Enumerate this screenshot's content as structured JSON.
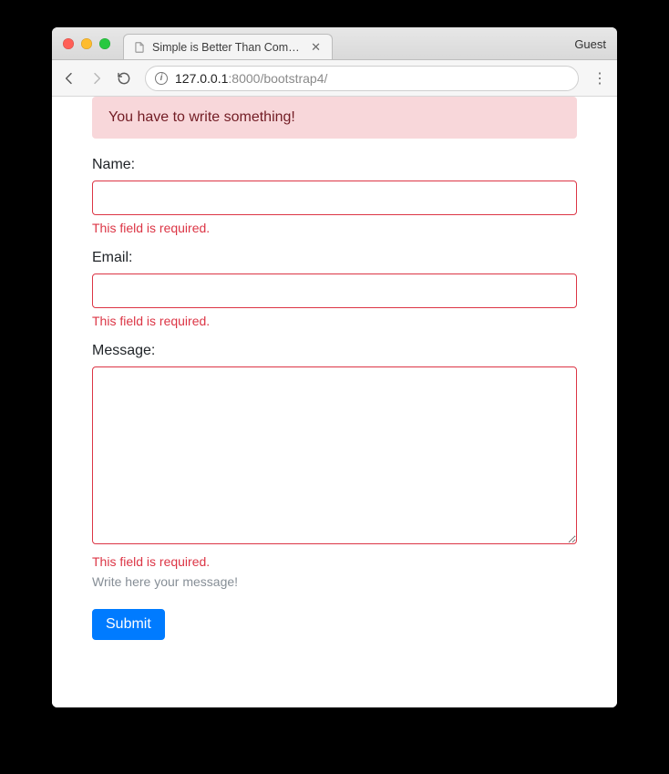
{
  "browser": {
    "tab_title": "Simple is Better Than Complex",
    "guest_label": "Guest",
    "url_host": "127.0.0.1",
    "url_port": ":8000",
    "url_path": "/bootstrap4/"
  },
  "alert": {
    "message": "You have to write something!"
  },
  "form": {
    "name_label": "Name:",
    "name_error": "This field is required.",
    "email_label": "Email:",
    "email_error": "This field is required.",
    "message_label": "Message:",
    "message_error": "This field is required.",
    "message_help": "Write here your message!",
    "submit_label": "Submit"
  }
}
